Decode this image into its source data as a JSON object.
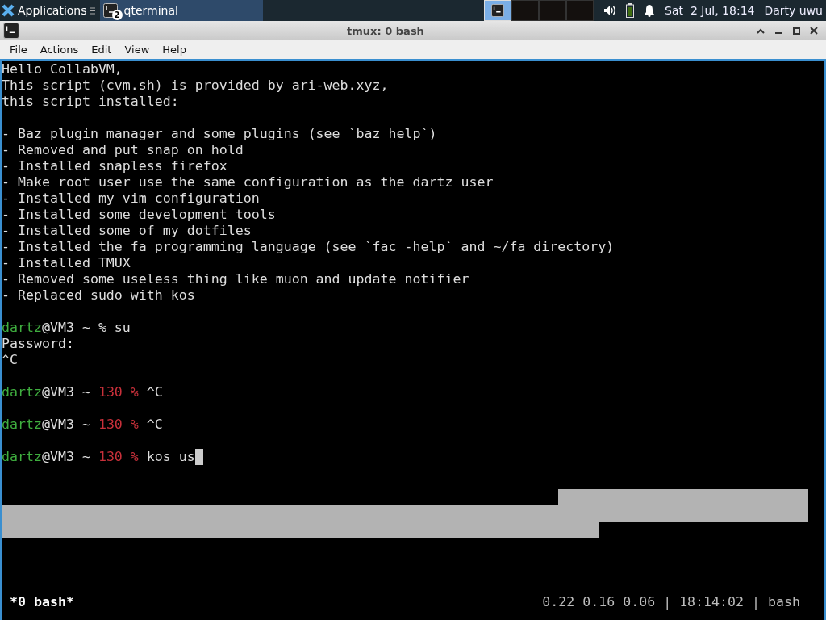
{
  "taskbar": {
    "apps_label": "Applications",
    "tasks": [
      {
        "label": "qterminal",
        "badge": "2",
        "selected": true
      }
    ],
    "workspaces": [
      {
        "selected": true
      },
      {
        "selected": false
      },
      {
        "selected": false
      },
      {
        "selected": false
      }
    ],
    "clock": "Sat  2 Jul, 18:14",
    "user": "Darty uwu"
  },
  "window": {
    "title": "tmux: 0 bash"
  },
  "menu": [
    "File",
    "Actions",
    "Edit",
    "View",
    "Help"
  ],
  "terminal": {
    "blocks": [
      [
        [
          {
            "kind": "plain",
            "text": "Hello CollabVM,"
          }
        ],
        [
          {
            "kind": "plain",
            "text": "This script (cvm.sh) is provided by ari-web.xyz,"
          }
        ],
        [
          {
            "kind": "plain",
            "text": "this script installed:"
          }
        ]
      ],
      [
        [
          {
            "kind": "plain",
            "text": "- Baz plugin manager and some plugins (see `baz help`)"
          }
        ],
        [
          {
            "kind": "plain",
            "text": "- Removed and put snap on hold"
          }
        ],
        [
          {
            "kind": "plain",
            "text": "- Installed snapless firefox"
          }
        ],
        [
          {
            "kind": "plain",
            "text": "- Make root user use the same configuration as the dartz user"
          }
        ],
        [
          {
            "kind": "plain",
            "text": "- Installed my vim configuration"
          }
        ],
        [
          {
            "kind": "plain",
            "text": "- Installed some development tools"
          }
        ],
        [
          {
            "kind": "plain",
            "text": "- Installed some of my dotfiles"
          }
        ],
        [
          {
            "kind": "plain",
            "text": "- Installed the fa programming language (see `fac -help` and ~/fa directory)"
          }
        ],
        [
          {
            "kind": "plain",
            "text": "- Installed TMUX"
          }
        ],
        [
          {
            "kind": "plain",
            "text": "- Removed some useless thing like muon and update notifier"
          }
        ],
        [
          {
            "kind": "plain",
            "text": "- Replaced sudo with kos"
          }
        ]
      ],
      [
        [
          {
            "kind": "user",
            "text": "dartz"
          },
          {
            "kind": "plain",
            "text": "@VM3 ~ % su"
          }
        ],
        [
          {
            "kind": "plain",
            "text": "Password:"
          }
        ],
        [
          {
            "kind": "plain",
            "text": "^C"
          }
        ]
      ],
      [
        [
          {
            "kind": "user",
            "text": "dartz"
          },
          {
            "kind": "plain",
            "text": "@VM3 ~ "
          },
          {
            "kind": "error",
            "text": "130 %"
          },
          {
            "kind": "plain",
            "text": " ^C"
          }
        ]
      ],
      [
        [
          {
            "kind": "user",
            "text": "dartz"
          },
          {
            "kind": "plain",
            "text": "@VM3 ~ "
          },
          {
            "kind": "error",
            "text": "130 %"
          },
          {
            "kind": "plain",
            "text": " ^C"
          }
        ]
      ],
      [
        [
          {
            "kind": "user",
            "text": "dartz"
          },
          {
            "kind": "plain",
            "text": "@VM3 ~ "
          },
          {
            "kind": "error",
            "text": "130 %"
          },
          {
            "kind": "plain",
            "text": " kos us"
          }
        ]
      ]
    ],
    "cursor_visible": true,
    "status_left": "*0 bash*",
    "status_right": "0.22 0.16 0.06 | 18:14:02 | bash"
  }
}
